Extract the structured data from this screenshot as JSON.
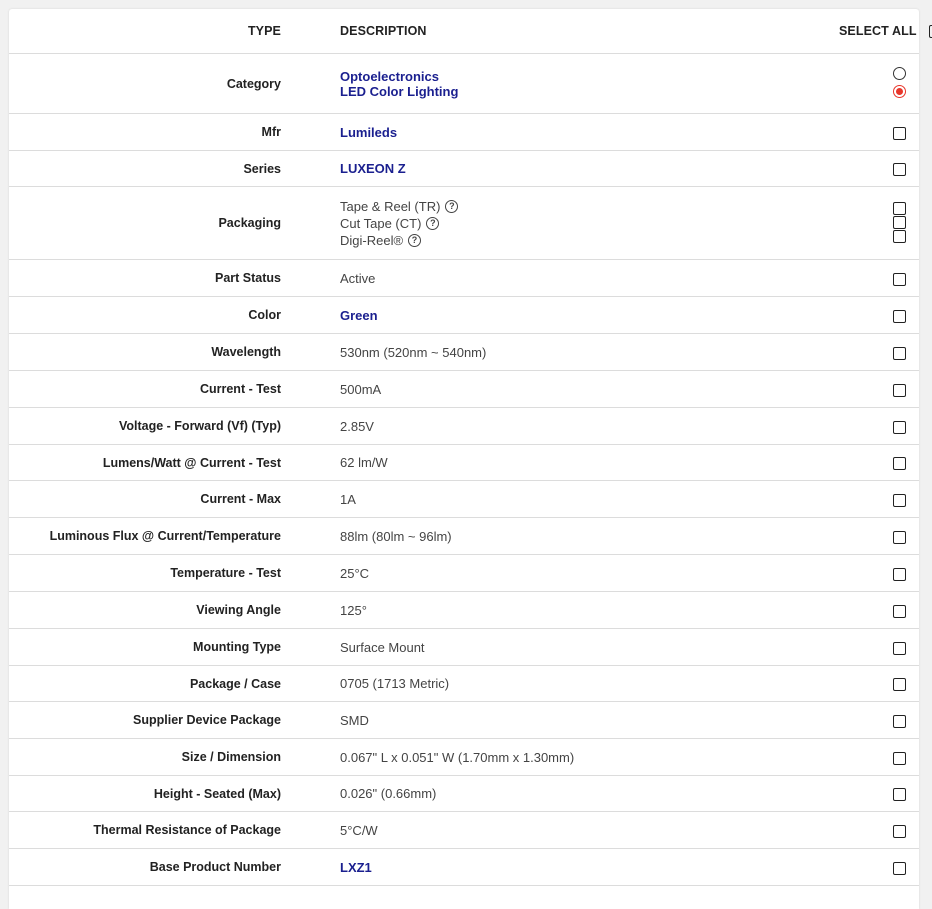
{
  "header": {
    "type": "TYPE",
    "description": "DESCRIPTION",
    "select_all": "SELECT ALL"
  },
  "rows": {
    "category": {
      "type": "Category",
      "values": [
        "Optoelectronics",
        "LED Color Lighting"
      ],
      "selected_index": 1
    },
    "mfr": {
      "type": "Mfr",
      "value": "Lumileds"
    },
    "series": {
      "type": "Series",
      "value": "LUXEON Z"
    },
    "packaging": {
      "type": "Packaging",
      "values": [
        "Tape & Reel (TR)",
        "Cut Tape (CT)",
        "Digi-Reel®"
      ]
    },
    "part_status": {
      "type": "Part Status",
      "value": "Active"
    },
    "color": {
      "type": "Color",
      "value": "Green"
    },
    "wavelength": {
      "type": "Wavelength",
      "value": "530nm (520nm ~ 540nm)"
    },
    "current_test": {
      "type": "Current - Test",
      "value": "500mA"
    },
    "voltage_forward": {
      "type": "Voltage - Forward (Vf) (Typ)",
      "value": "2.85V"
    },
    "lumens_watt": {
      "type": "Lumens/Watt @ Current - Test",
      "value": "62 lm/W"
    },
    "current_max": {
      "type": "Current - Max",
      "value": "1A"
    },
    "luminous_flux": {
      "type": "Luminous Flux @ Current/Temperature",
      "value": "88lm (80lm ~ 96lm)"
    },
    "temperature_test": {
      "type": "Temperature - Test",
      "value": "25°C"
    },
    "viewing_angle": {
      "type": "Viewing Angle",
      "value": "125°"
    },
    "mounting_type": {
      "type": "Mounting Type",
      "value": "Surface Mount"
    },
    "package_case": {
      "type": "Package / Case",
      "value": "0705 (1713 Metric)"
    },
    "supplier_package": {
      "type": "Supplier Device Package",
      "value": "SMD"
    },
    "size_dimension": {
      "type": "Size / Dimension",
      "value": "0.067\" L x 0.051\" W (1.70mm x 1.30mm)"
    },
    "height_seated": {
      "type": "Height - Seated (Max)",
      "value": "0.026\" (0.66mm)"
    },
    "thermal_resistance": {
      "type": "Thermal Resistance of Package",
      "value": "5°C/W"
    },
    "base_product_number": {
      "type": "Base Product Number",
      "value": "LXZ1"
    }
  },
  "colors": {
    "link": "#1a1f8f",
    "radio_selected": "#e8362a",
    "border": "#dcdcdc"
  },
  "icons": {
    "help": "question-circle-icon"
  }
}
